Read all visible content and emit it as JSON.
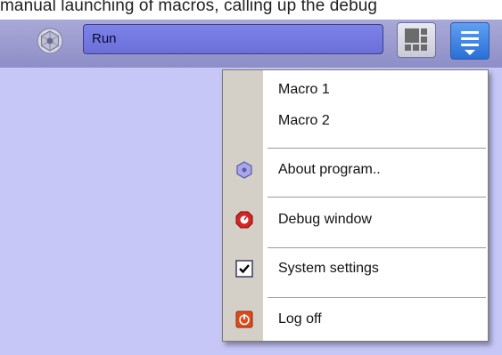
{
  "caption": "manual launching of macros, calling up the debug",
  "toolbar": {
    "run_value": "Run"
  },
  "menu": {
    "items": [
      {
        "label": "Macro 1"
      },
      {
        "label": "Macro 2"
      },
      {
        "label": "About program.."
      },
      {
        "label": "Debug window"
      },
      {
        "label": "System settings",
        "checked": true
      },
      {
        "label": "Log off"
      }
    ]
  },
  "icons": {
    "app": "hexagon-app-icon",
    "layout": "grid-layout-icon",
    "menu": "hamburger-menu-icon",
    "about": "hexagon-about-icon",
    "debug": "stop-debug-icon",
    "settings": "checkbox-icon",
    "logoff": "power-icon"
  },
  "colors": {
    "window_bg": "#c6c6f7",
    "run_field": "#7075dd",
    "menu_button": "#3c82e6"
  }
}
